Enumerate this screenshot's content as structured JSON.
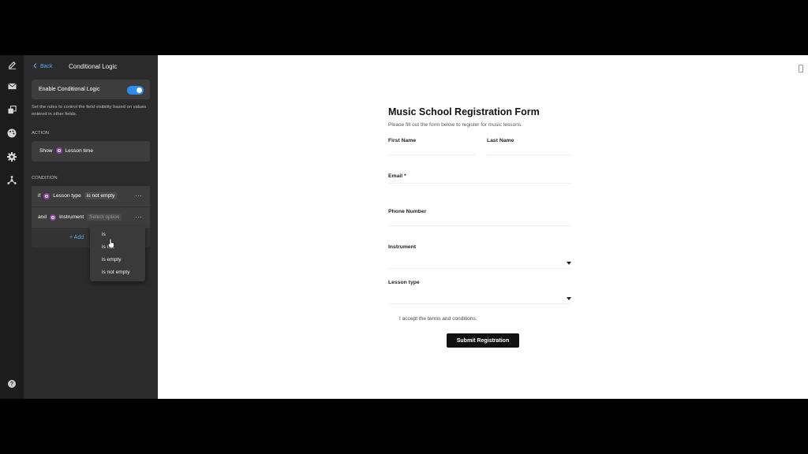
{
  "rail": {
    "icons": [
      "pencil-icon",
      "mail-icon",
      "layers-icon",
      "palette-icon",
      "gear-icon",
      "integrations-icon"
    ],
    "help": "?"
  },
  "panel": {
    "back_label": "Back",
    "title": "Conditional Logic",
    "toggle_label": "Enable Conditional Logic",
    "toggle_on": true,
    "help_text": "Set the rules to control the field visibility based on values entered in other fields.",
    "action_section": "ACTION",
    "action": {
      "verb": "Show",
      "field": "Lesson time"
    },
    "condition_section": "CONDITION",
    "conditions": [
      {
        "prefix": "if",
        "field": "Lesson type",
        "operator": "is not empty"
      },
      {
        "prefix": "and",
        "field": "Instrument",
        "operator_placeholder": "Select option"
      }
    ],
    "add_label": "Add",
    "menu_dots": "···"
  },
  "dropdown": {
    "options": [
      "is",
      "is not",
      "is empty",
      "is not empty"
    ]
  },
  "form": {
    "title": "Music School Registration Form",
    "subtitle": "Please fill out the form below to register for music lessons.",
    "first_name": "First Name",
    "last_name": "Last Name",
    "email": "Email *",
    "phone": "Phone Number",
    "instrument": "Instrument",
    "lesson_type": "Lesson type",
    "terms": "I accept the terms and conditions.",
    "submit": "Submit Registration"
  },
  "colors": {
    "accent": "#2d8cf0",
    "link": "#5aa9f5",
    "field_chip": "#8e44ad",
    "panel_bg": "#2b2b2b"
  }
}
